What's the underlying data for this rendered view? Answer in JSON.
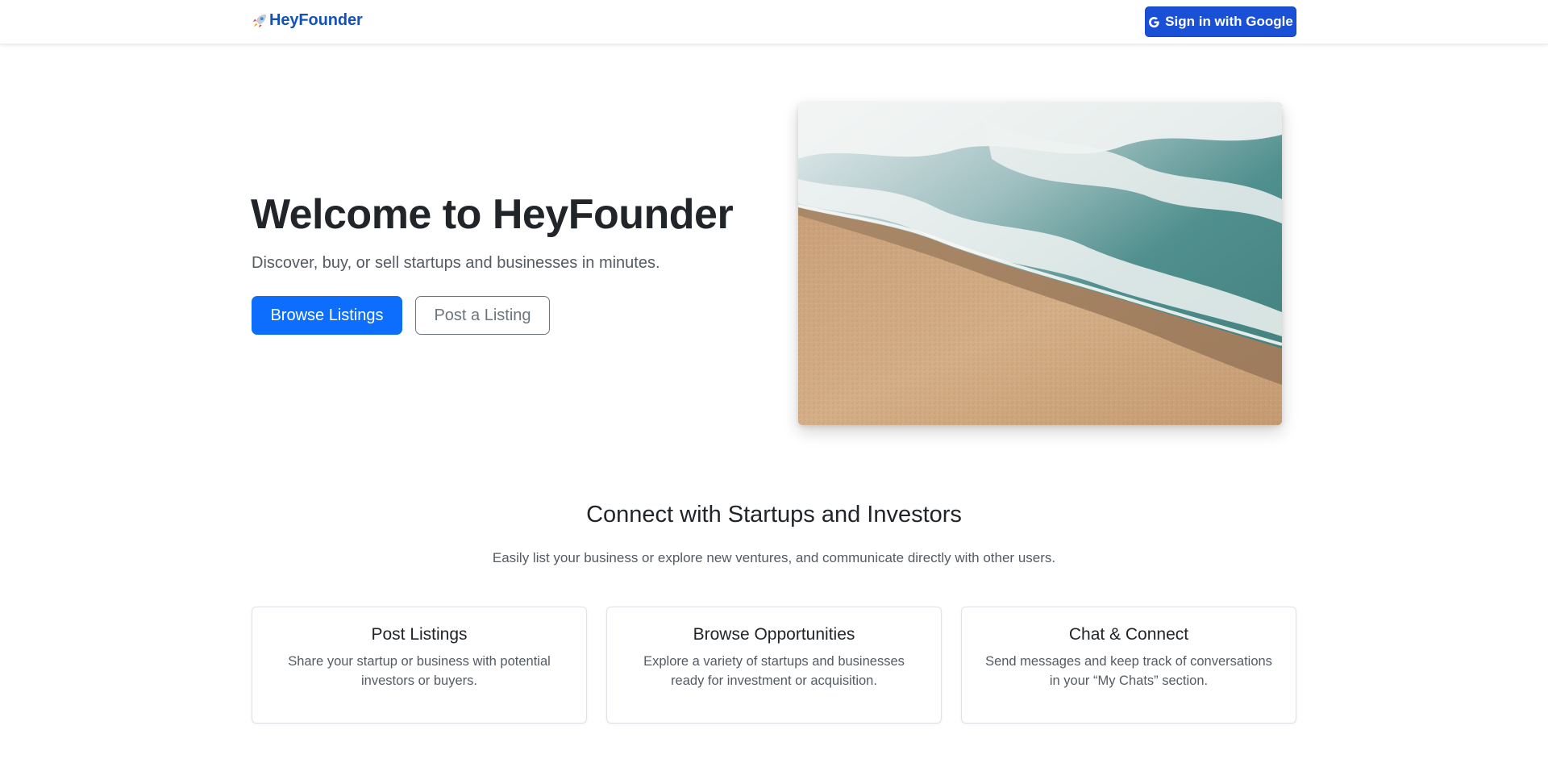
{
  "navbar": {
    "brand": "HeyFounder",
    "brand_icon": "rocket-icon",
    "signin_label": "Sign in with Google",
    "signin_icon": "google-icon",
    "accent_color": "#1a50d6"
  },
  "hero": {
    "title": "Welcome to HeyFounder",
    "subtitle": "Discover, buy, or sell startups and businesses in minutes.",
    "primary_button": "Browse Listings",
    "secondary_button": "Post a Listing",
    "image_alt": "Aerial view of ocean waves meeting a sandy beach"
  },
  "connect": {
    "title": "Connect with Startups and Investors",
    "subtitle": "Easily list your business or explore new ventures, and communicate directly with other users.",
    "cards": [
      {
        "title": "Post Listings",
        "text": "Share your startup or business with potential investors or buyers."
      },
      {
        "title": "Browse Opportunities",
        "text": "Explore a variety of startups and businesses ready for investment or acquisition."
      },
      {
        "title": "Chat & Connect",
        "text": "Send messages and keep track of conversations in your “My Chats” section."
      }
    ]
  }
}
